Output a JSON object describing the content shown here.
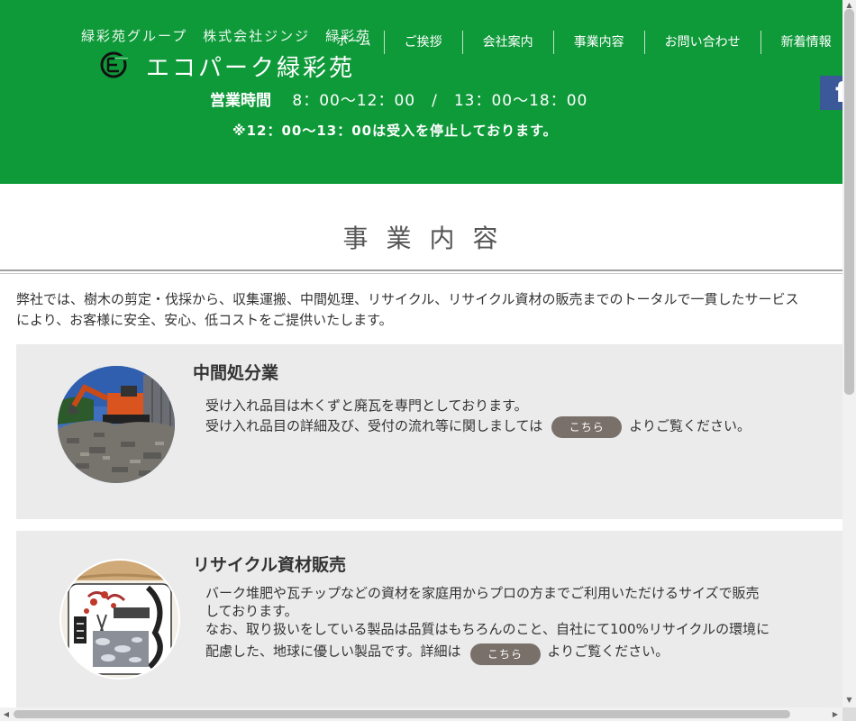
{
  "header": {
    "company": "緑彩苑グループ　株式会社ジンジ　緑彩苑",
    "brand": "エコパーク緑彩苑",
    "hours_label": "営業時間",
    "hours_text": "8：00〜12：00　/　13：00〜18：00",
    "notice": "※12：00〜13：00は受入を停止しております。",
    "bg_color": "#0f9a3a"
  },
  "nav": {
    "items": [
      "ホーム",
      "ご挨拶",
      "会社案内",
      "事業内容",
      "お問い合わせ",
      "新着情報"
    ]
  },
  "social": {
    "facebook_glyph": "f"
  },
  "page": {
    "title": "事業内容",
    "intro_line1": "弊社では、樹木の剪定・伐採から、収集運搬、中間処理、リサイクル、リサイクル資材の販売までのトータルで一貫したサービス",
    "intro_line2": "により、お客様に安全、安心、低コストをご提供いたします。"
  },
  "sections": [
    {
      "title": "中間処分業",
      "line1": "受け入れ品目は木くずと廃瓦を専門としております。",
      "line2_pre": "受け入れ品目の詳細及び、受付の流れ等に関しましては",
      "button": "こちら",
      "line2_post": "よりご覧ください。",
      "image": "excavator-photo"
    },
    {
      "title": "リサイクル資材販売",
      "line1": "バーク堆肥や瓦チップなどの資材を家庭用からプロの方までご利用いただけるサイズで販売",
      "line2": "しております。",
      "line3": "なお、取り扱いをしている製品は品質はもちろんのこと、自社にて100%リサイクルの環境に",
      "line4_pre": "配慮した、地球に優しい製品です。詳細は",
      "button": "こちら",
      "line4_post": "よりご覧ください。",
      "image": "product-bag-photo"
    }
  ]
}
